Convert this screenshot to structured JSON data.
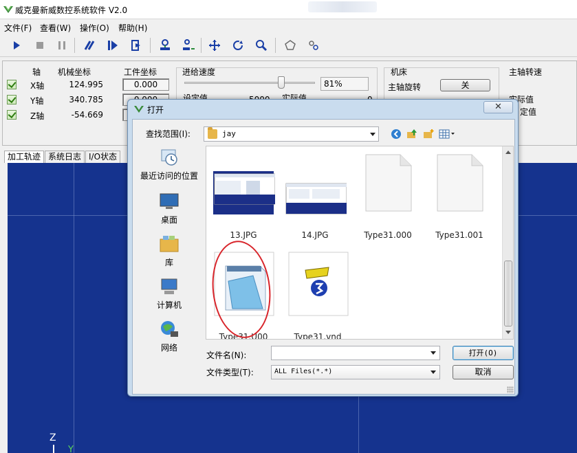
{
  "window": {
    "title": "威克曼新威数控系统软件 V2.0"
  },
  "menu": [
    "文件(F)",
    "查看(W)",
    "操作(O)",
    "帮助(H)"
  ],
  "toolbar_icons": [
    "play-icon",
    "stop-icon",
    "pause-icon",
    "step-icon",
    "skip-icon",
    "goto-line-icon",
    "tool-set-icon",
    "tool-offset-icon",
    "move-icon",
    "rotate-icon",
    "zoom-icon",
    "polygon-icon",
    "settings-icon"
  ],
  "status": {
    "headers": {
      "axis": "轴",
      "machine": "机械坐标",
      "work": "工件坐标"
    },
    "axes": [
      {
        "name": "X轴",
        "machine": "124.995",
        "work": "0.000"
      },
      {
        "name": "Y轴",
        "machine": "340.785",
        "work": "0.000"
      },
      {
        "name": "Z轴",
        "machine": "-54.669",
        "work": ""
      }
    ],
    "feed": {
      "label": "进给速度",
      "percent": "81%",
      "value": 0.81,
      "set_label": "设定值",
      "set_value": "5000",
      "actual_label": "实际值",
      "actual_value": "0"
    },
    "machine": {
      "label": "机床",
      "spindle_label": "主轴旋转",
      "spindle_btn": "关"
    },
    "spindle_speed": {
      "label": "主轴转速",
      "actual_label": "实际值",
      "set_label": "定值"
    }
  },
  "tabs": [
    "加工轨迹",
    "系统日志",
    "I/O状态"
  ],
  "canvas_axes": {
    "z": "Z",
    "y": "Y"
  },
  "dialog": {
    "title": "打开",
    "close": "✕",
    "look_in_label": "查找范围(I):",
    "look_in_value": "jay",
    "places": [
      "最近访问的位置",
      "桌面",
      "库",
      "计算机",
      "网络"
    ],
    "files": [
      {
        "name": "13.JPG",
        "kind": "screenshot"
      },
      {
        "name": "14.JPG",
        "kind": "screenshot"
      },
      {
        "name": "Type31.000",
        "kind": "blank"
      },
      {
        "name": "Type31.001",
        "kind": "blank"
      },
      {
        "name": "Type31.U00",
        "kind": "notepad"
      },
      {
        "name": "Type31.vnd",
        "kind": "type3"
      }
    ],
    "filename_label": "文件名(N):",
    "filename_value": "",
    "filetype_label": "文件类型(T):",
    "filetype_value": "ALL Files(*.*)",
    "open_btn": "打开(O)",
    "cancel_btn": "取消"
  }
}
